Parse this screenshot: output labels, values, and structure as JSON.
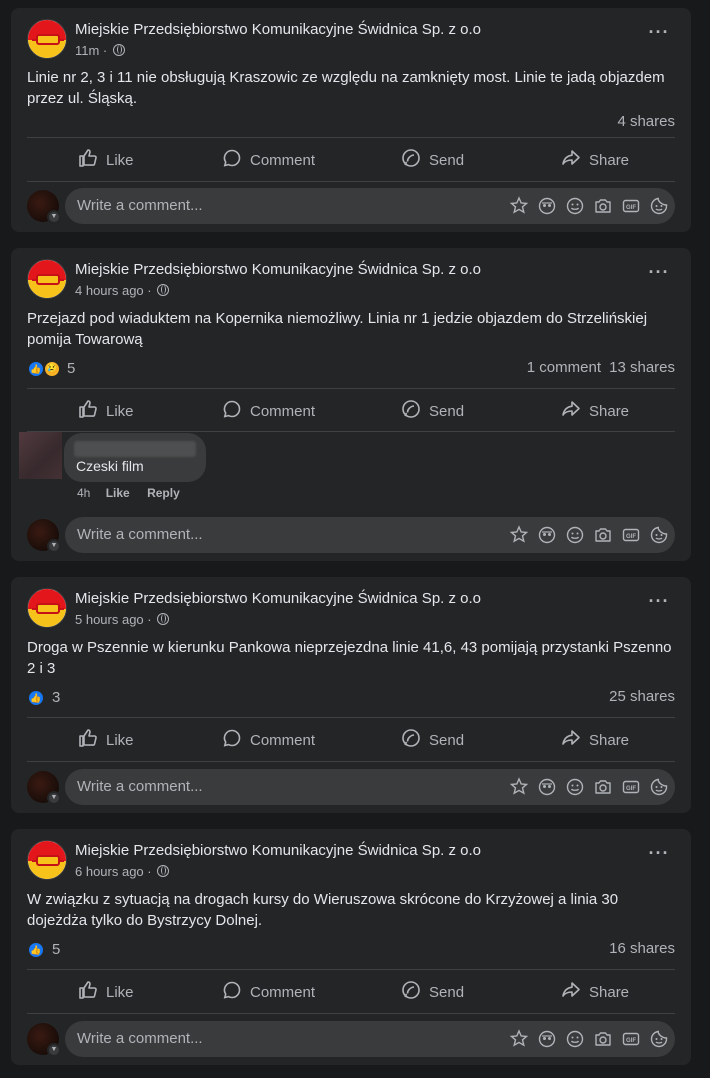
{
  "page_name": "Miejskie Przedsiębiorstwo Komunikacyjne Świdnica Sp. z o.o",
  "actions": {
    "like": "Like",
    "comment": "Comment",
    "send": "Send",
    "share": "Share"
  },
  "composer": {
    "placeholder": "Write a comment..."
  },
  "posts": [
    {
      "time": "11m ·",
      "text": "Linie nr 2, 3 i 11 nie obsługują Kraszowic ze względu na zamknięty most. Linie te jadą objazdem przez ul. Śląską.",
      "shares": "4 shares"
    },
    {
      "time": "4 hours ago ·",
      "text": "Przejazd pod  wiaduktem na Kopernika niemożliwy. Linia nr 1 jedzie objazdem do Strzelińskiej pomija Towarową",
      "reactions": "5",
      "comments": "1 comment",
      "shares": "13 shares",
      "comment": {
        "text": "Czeski film",
        "time": "4h",
        "like": "Like",
        "reply": "Reply"
      }
    },
    {
      "time": "5 hours ago ·",
      "text": "Droga w Pszennie w kierunku Pankowa nieprzejezdna linie 41,6, 43 pomijają przystanki Pszenno 2 i 3",
      "reactions": "3",
      "shares": "25 shares"
    },
    {
      "time": "6 hours ago ·",
      "text": "W związku z sytuacją na drogach kursy do Wieruszowa skrócone do Krzyżowej a linia 30 dojeżdża tylko do Bystrzycy Dolnej.",
      "reactions": "5",
      "shares": "16 shares"
    }
  ],
  "colors": {
    "background": "#18191a",
    "card": "#242526",
    "like_blue": "#1877f2",
    "sad_yellow": "#f7b125",
    "text": "#e4e6eb",
    "muted": "#b0b3b8"
  },
  "icons": [
    "like-icon",
    "comment-icon",
    "send-icon",
    "share-icon",
    "more-options-icon",
    "globe-icon",
    "avatar-icon",
    "sticker-icon",
    "emoji-icon",
    "camera-icon",
    "gif-icon"
  ]
}
